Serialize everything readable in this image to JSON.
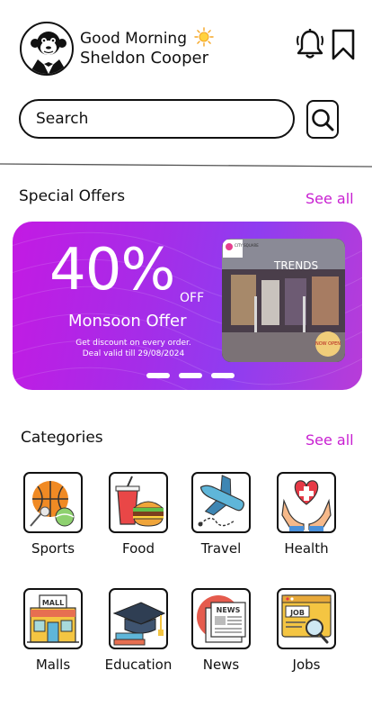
{
  "header": {
    "greeting": "Good Morning",
    "user_name": "Sheldon Cooper"
  },
  "search": {
    "placeholder": "Search"
  },
  "special_offers": {
    "title": "Special Offers",
    "see_all": "See all",
    "banner": {
      "percent": "40%",
      "off": "OFF",
      "name": "Monsoon Offer",
      "line1": "Get discount on every order.",
      "line2": "Deal valid till 29/08/2024",
      "store_sign": "TRENDS",
      "badge": "NOW OPEN",
      "mall_logo": "CITY SQUARE",
      "slide_count": 3
    }
  },
  "categories": {
    "title": "Categories",
    "see_all": "See all",
    "items": [
      {
        "label": "Sports",
        "icon": "sports-icon"
      },
      {
        "label": "Food",
        "icon": "food-icon"
      },
      {
        "label": "Travel",
        "icon": "travel-icon"
      },
      {
        "label": "Health",
        "icon": "health-icon"
      },
      {
        "label": "Malls",
        "icon": "malls-icon"
      },
      {
        "label": "Education",
        "icon": "education-icon"
      },
      {
        "label": "News",
        "icon": "news-icon"
      },
      {
        "label": "Jobs",
        "icon": "jobs-icon"
      }
    ]
  },
  "colors": {
    "accent": "#c81fd1",
    "banner_start": "#c31ae3",
    "banner_end": "#8f3df0"
  }
}
